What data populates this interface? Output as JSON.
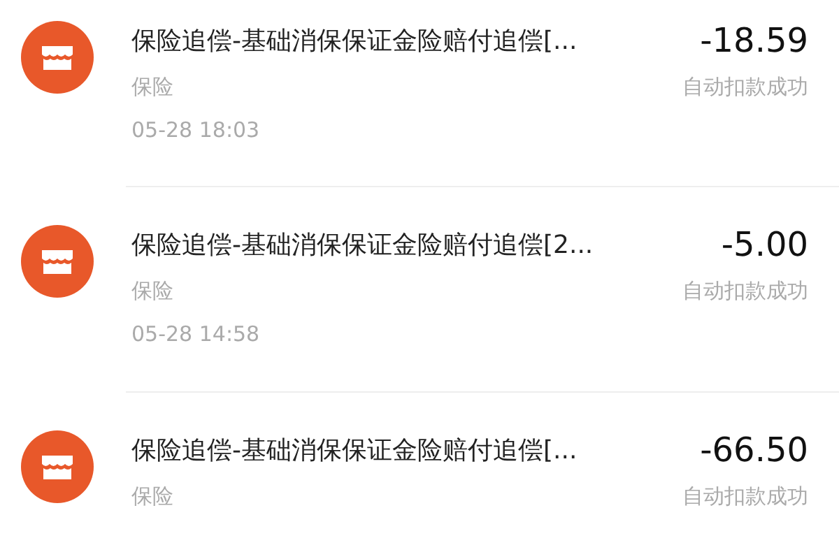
{
  "transactions": [
    {
      "title": "保险追偿-基础消保保证金险赔付追偿[...",
      "amount": "-18.59",
      "category": "保险",
      "status": "自动扣款成功",
      "time": "05-28  18:03"
    },
    {
      "title": "保险追偿-基础消保保证金险赔付追偿[2...",
      "amount": "-5.00",
      "category": "保险",
      "status": "自动扣款成功",
      "time": "05-28  14:58"
    },
    {
      "title": "保险追偿-基础消保保证金险赔付追偿[...",
      "amount": "-66.50",
      "category": "保险",
      "status": "自动扣款成功"
    }
  ]
}
